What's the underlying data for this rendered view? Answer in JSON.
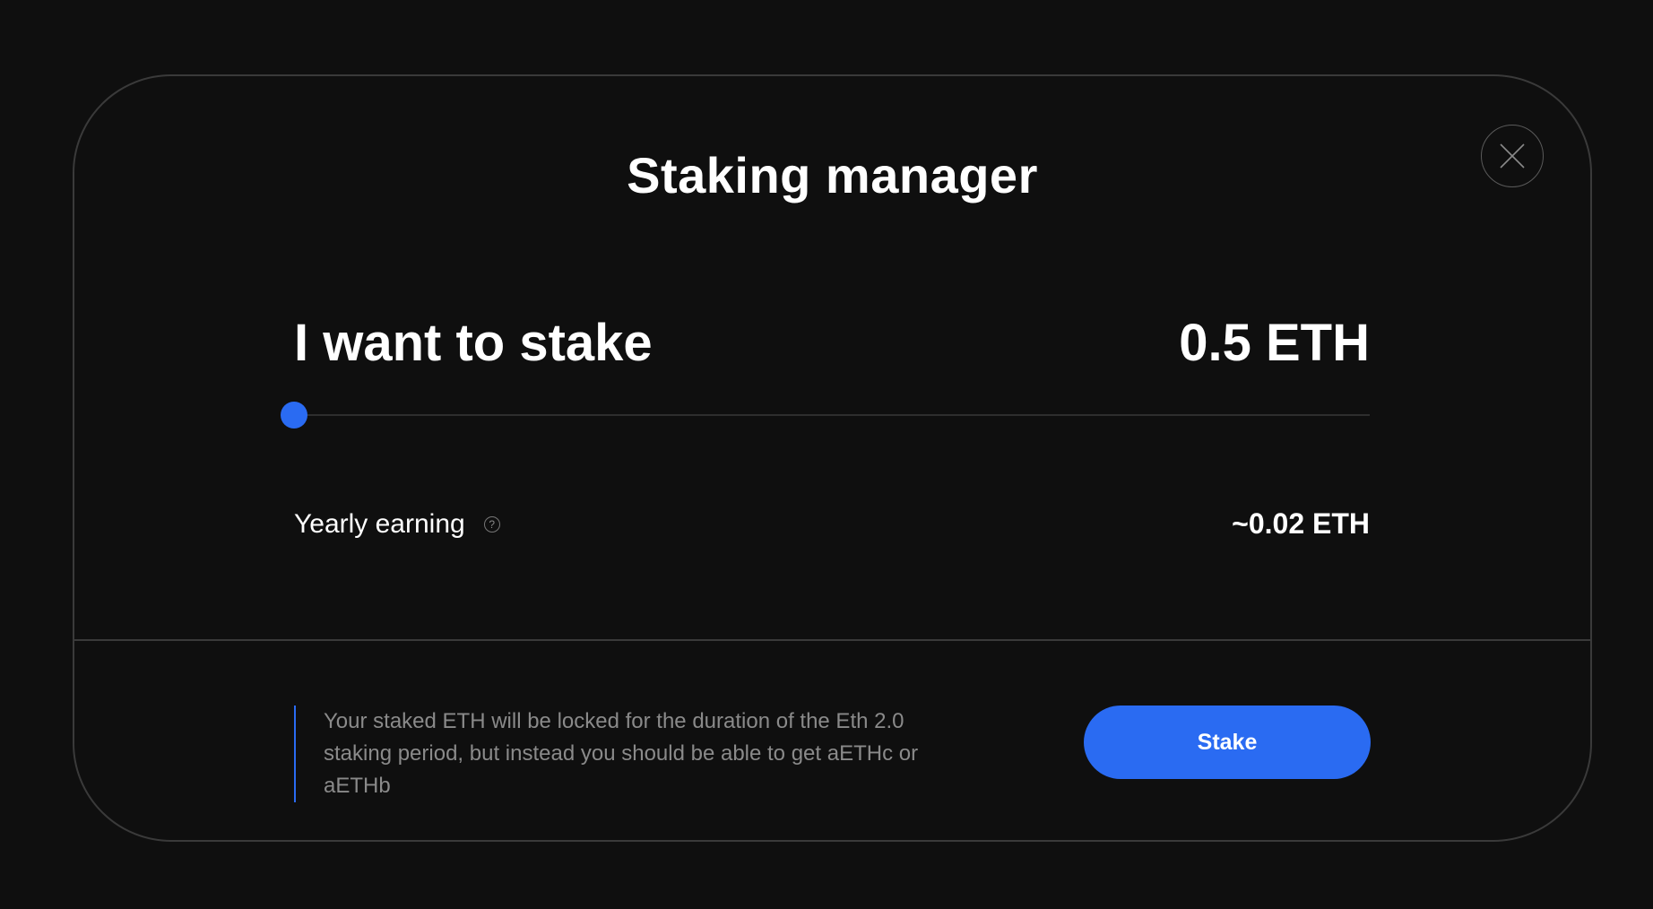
{
  "modal": {
    "title": "Staking manager",
    "close_icon": "close-icon"
  },
  "stake": {
    "label": "I want to stake",
    "amount": "0.5 ETH",
    "slider_fraction": 0
  },
  "earning": {
    "label": "Yearly earning",
    "help_icon": "question-mark-icon",
    "help_glyph": "?",
    "value": "~0.02 ETH"
  },
  "footer": {
    "notice": "Your staked ETH will be locked for the duration of the Eth 2.0 staking period, but instead you should be able to get aETHc or aETHb",
    "stake_button_label": "Stake"
  },
  "colors": {
    "accent": "#2a6bf2",
    "background": "#0f0f0f",
    "border": "#3a3a3a",
    "muted_text": "#8a8a8a"
  }
}
